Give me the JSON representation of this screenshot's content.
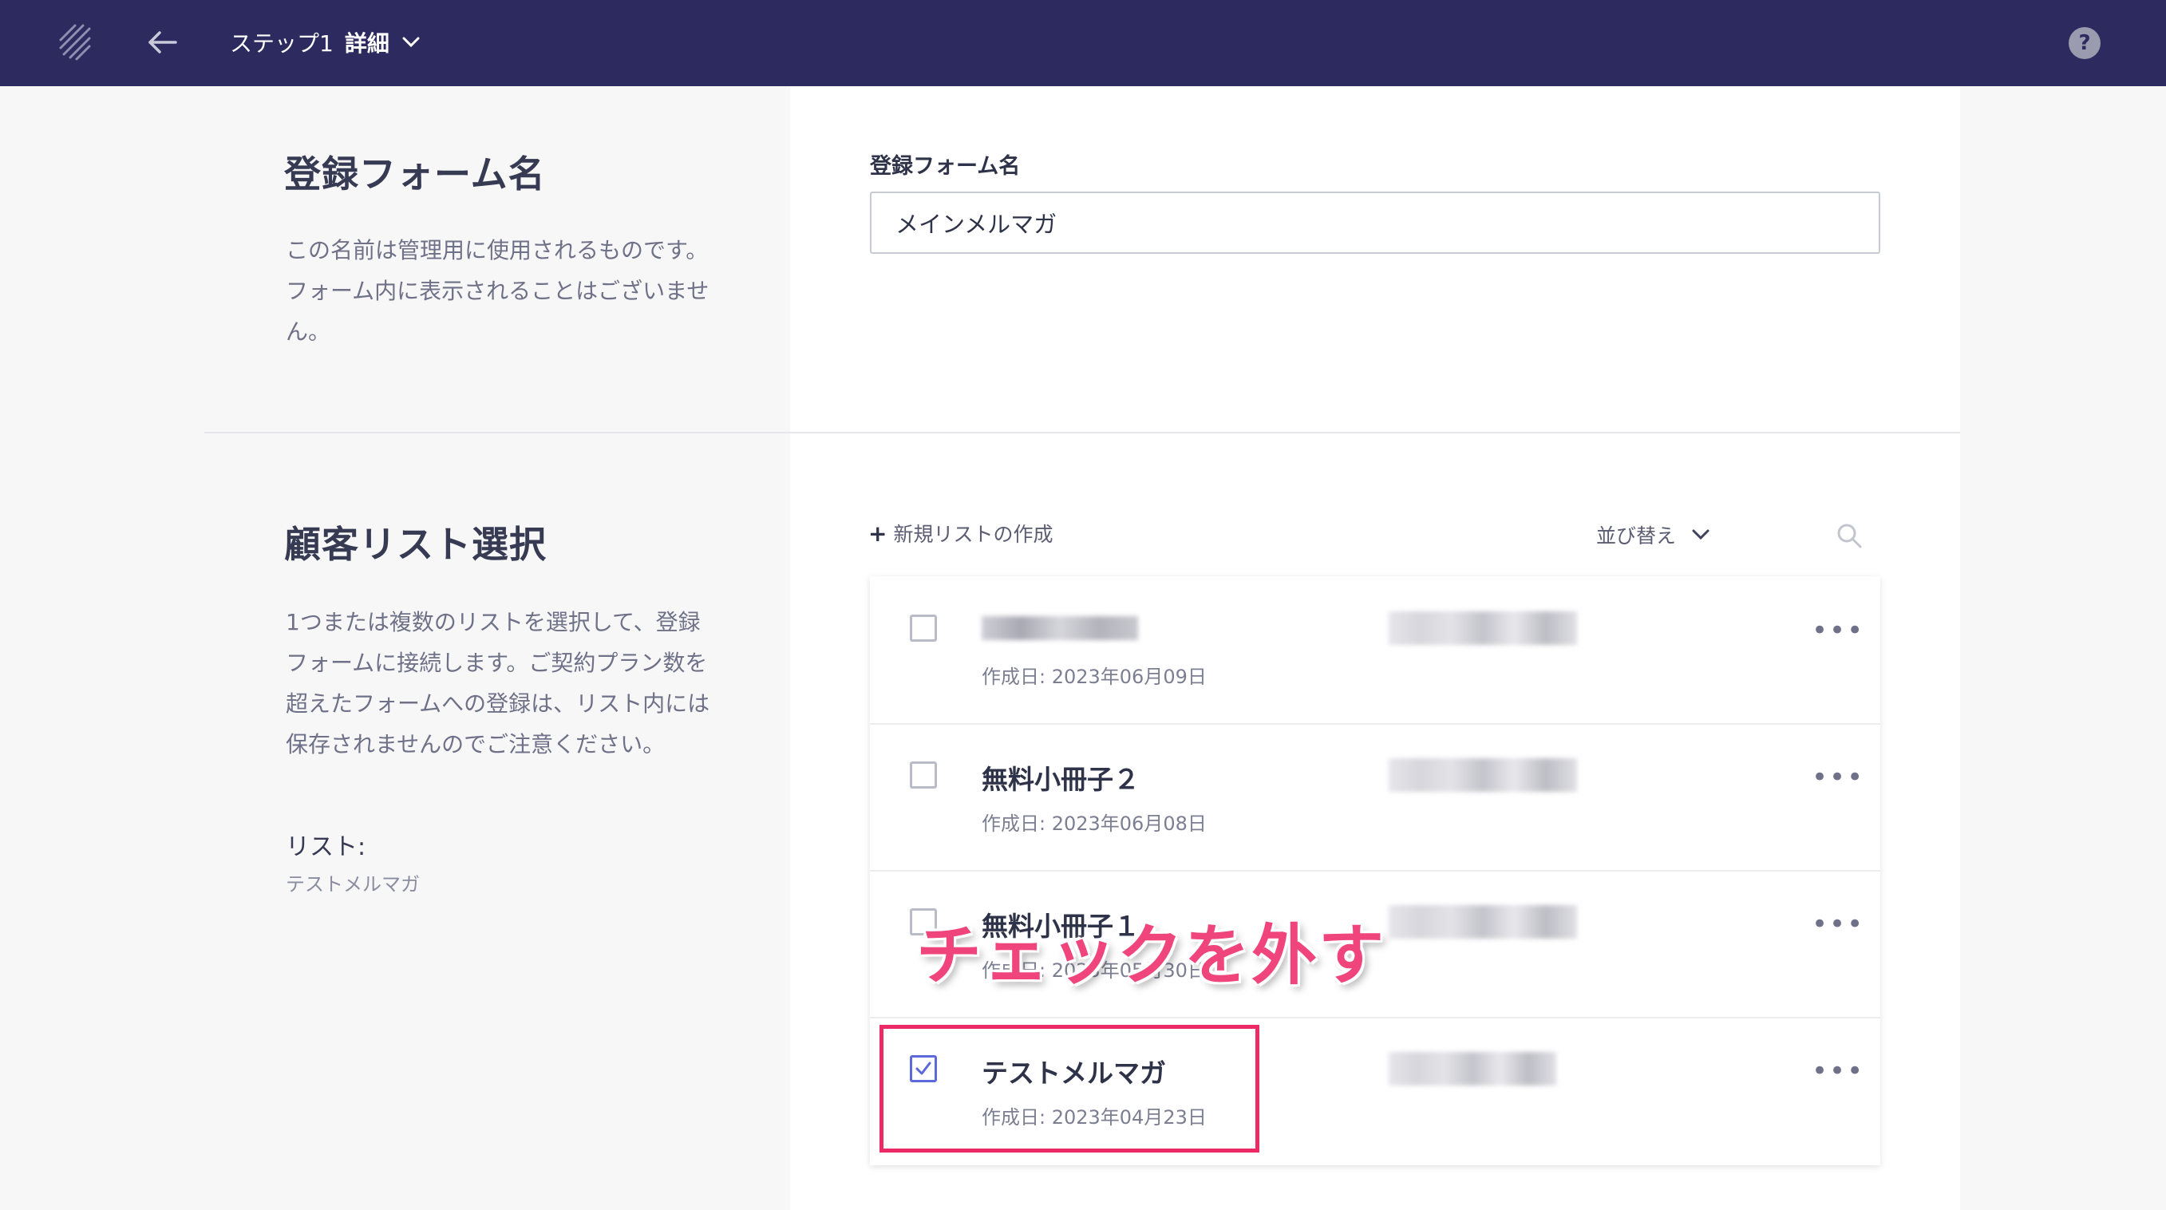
{
  "header": {
    "step_label": "ステップ1",
    "step_detail": "詳細",
    "help_label": "?"
  },
  "form_name_section": {
    "title": "登録フォーム名",
    "description_lines": [
      "この名前は管理用に使用されるものです。",
      "フォーム内に表示されることはございませ",
      "ん。"
    ],
    "field_label": "登録フォーム名",
    "field_value": "メインメルマガ"
  },
  "list_section": {
    "title": "顧客リスト選択",
    "description_lines": [
      "1つまたは複数のリストを選択して、登録",
      "フォームに接続します。ご契約プラン数を",
      "超えたフォームへの登録は、リスト内には",
      "保存されませんのでご注意ください。"
    ],
    "list_label": "リスト:",
    "list_value": "テストメルマガ",
    "new_list": "新規リストの作成",
    "sort_label": "並び替え",
    "items": [
      {
        "name": "",
        "date": "作成日: 2023年06月09日",
        "checked": false
      },
      {
        "name": "無料小冊子２",
        "date": "作成日: 2023年06月08日",
        "checked": false
      },
      {
        "name": "無料小冊子１",
        "date": "作成日: 2023年05月30日",
        "checked": false
      },
      {
        "name": "テストメルマガ",
        "date": "作成日: 2023年04月23日",
        "checked": true
      }
    ],
    "more_label": "•••"
  },
  "annotation": {
    "text": "チェックを外す",
    "color": "#ec2b66"
  },
  "colors": {
    "topbar": "#2c2a5e",
    "accent": "#5b6ad8"
  }
}
